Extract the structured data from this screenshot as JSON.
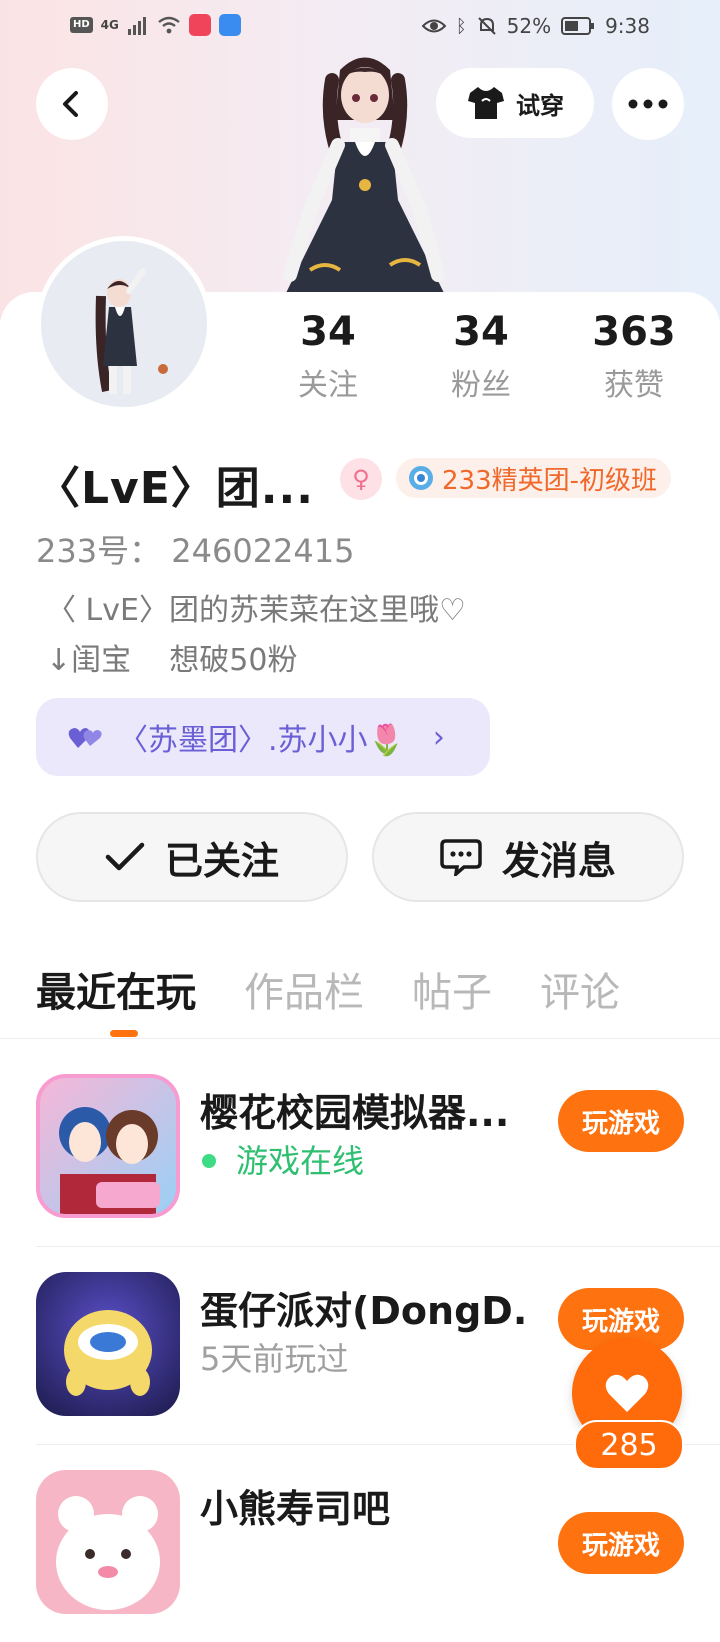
{
  "status_bar": {
    "left_chips": [
      "HD",
      "4G"
    ],
    "battery": "52%",
    "time": "9:38"
  },
  "header": {
    "try_on_label": "试穿",
    "icons": {
      "back": "chevron-left-icon",
      "shirt": "shirt-icon",
      "more": "more-horizontal-icon"
    }
  },
  "stats": {
    "following": {
      "value": "34",
      "label": "关注"
    },
    "followers": {
      "value": "34",
      "label": "粉丝"
    },
    "likes": {
      "value": "363",
      "label": "获赞"
    }
  },
  "profile": {
    "name": "〈LvE〉团...",
    "gender": "female",
    "badge": "233精英团-初级班",
    "uid": "233号：  246022415",
    "bio": "〈 LvE〉团的苏茉菜在这里哦♡\n↓闺宝    想破50粉",
    "friend_link": "〈苏墨团〉.苏小小🌷"
  },
  "actions": {
    "follow_label": "已关注",
    "message_label": "发消息"
  },
  "tabs": [
    "最近在玩",
    "作品栏",
    "帖子",
    "评论"
  ],
  "active_tab": 0,
  "games": [
    {
      "title": "樱花校园模拟器...",
      "status": "游戏在线",
      "online": true,
      "button": "玩游戏"
    },
    {
      "title": "蛋仔派对(DongD...",
      "status": "5天前玩过",
      "online": false,
      "button": "玩游戏"
    },
    {
      "title": "小熊寿司吧",
      "status": "",
      "online": false,
      "button": "玩游戏"
    }
  ],
  "like_fab": {
    "count": "285"
  },
  "colors": {
    "accent": "#ff7210",
    "purple": "#6b5fd6",
    "online": "#2fbf71"
  }
}
